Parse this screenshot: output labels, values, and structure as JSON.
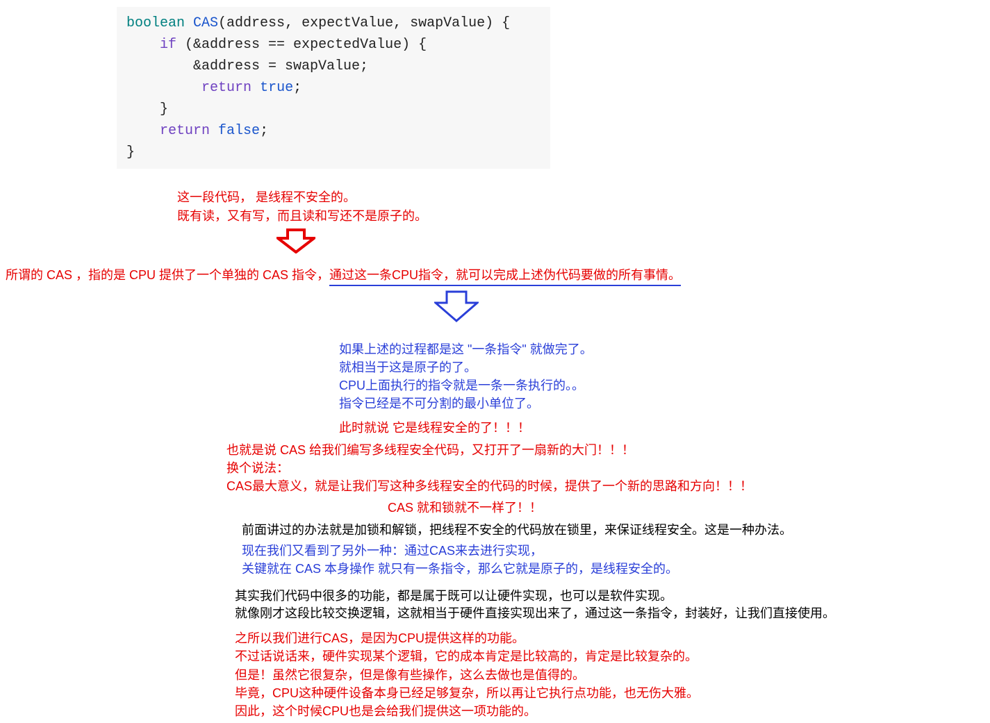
{
  "code": {
    "sig_boolean": "boolean",
    "sig_fn": "CAS",
    "sig_params": "(address, expectValue, swapValue) {",
    "if_kw": "if",
    "if_cond": " (&address == expectedValue) {",
    "assign": "        &address = swapValue;",
    "ret1_kw": "return",
    "ret1_val": "true",
    "ret1_semi": ";",
    "closebrace1": "    }",
    "ret2_kw": "return",
    "ret2_val": "false",
    "ret2_semi": ";",
    "closebrace2": "}"
  },
  "annot1": {
    "line1": "这一段代码，  是线程不安全的。",
    "line2": "既有读，又有写，而且读和写还不是原子的。"
  },
  "main": {
    "part1": "所谓的 CAS ，指的是 CPU 提供了一个单独的 CAS 指令，",
    "part2": "通过这一条CPU指令，就可以完成上述伪代码要做的所有事情。"
  },
  "blue1": {
    "l1": "如果上述的过程都是这 \"一条指令\" 就做完了。",
    "l2": "就相当于这是原子的了。",
    "l3": "CPU上面执行的指令就是一条一条执行的。。",
    "l4": "指令已经是不可分割的最小单位了。"
  },
  "red1": "此时就说 它是线程安全的了！！！",
  "red2": {
    "l1": "也就是说 CAS 给我们编写多线程安全代码，又打开了一扇新的大门！！！",
    "l2": "换个说法：",
    "l3": "CAS最大意义，就是让我们写这种多线程安全的代码的时候，提供了一个新的思路和方向！！！"
  },
  "red3": "CAS 就和锁就不一样了！！",
  "black1": "前面讲过的办法就是加锁和解锁，把线程不安全的代码放在锁里，来保证线程安全。这是一种办法。",
  "blue2": {
    "l1": "现在我们又看到了另外一种：通过CAS来去进行实现，",
    "l2": "关键就在 CAS 本身操作 就只有一条指令，那么它就是原子的，是线程安全的。"
  },
  "black2": {
    "l1": "其实我们代码中很多的功能，都是属于既可以让硬件实现，也可以是软件实现。",
    "l2": "就像刚才这段比较交换逻辑，这就相当于硬件直接实现出来了，通过这一条指令，封装好，让我们直接使用。"
  },
  "red4": {
    "l1": "之所以我们进行CAS，是因为CPU提供这样的功能。",
    "l2": "不过话说话来，硬件实现某个逻辑，它的成本肯定是比较高的，肯定是比较复杂的。",
    "l3": "但是！虽然它很复杂，但是像有些操作，这么去做也是值得的。",
    "l4": "毕竟，CPU这种硬件设备本身已经足够复杂，所以再让它执行点功能，也无伤大雅。",
    "l5": "因此，这个时候CPU也是会给我们提供这一项功能的。"
  }
}
